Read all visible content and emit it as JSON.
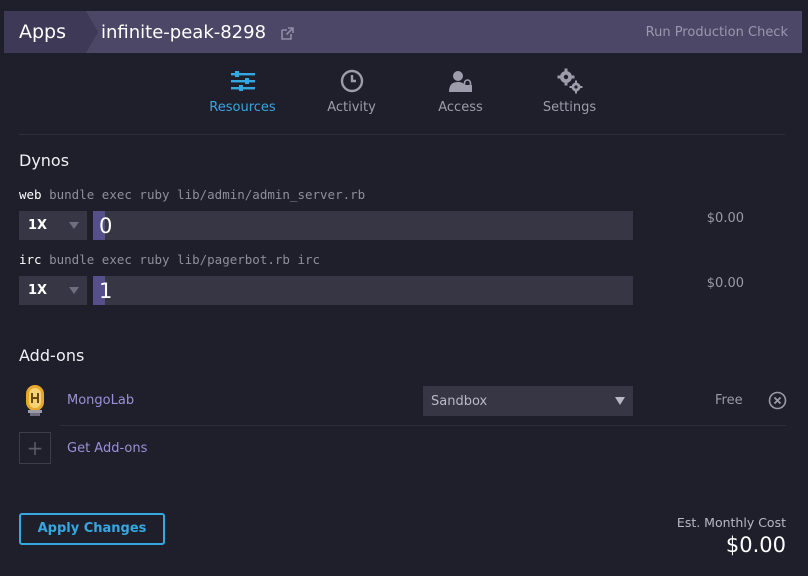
{
  "header": {
    "apps_label": "Apps",
    "app_name": "infinite-peak-8298",
    "run_check_label": "Run Production Check"
  },
  "tabs": [
    {
      "label": "Resources",
      "icon": "sliders-icon",
      "active": true
    },
    {
      "label": "Activity",
      "icon": "clock-icon",
      "active": false
    },
    {
      "label": "Access",
      "icon": "user-lock-icon",
      "active": false
    },
    {
      "label": "Settings",
      "icon": "gears-icon",
      "active": false
    }
  ],
  "dynos": {
    "title": "Dynos",
    "items": [
      {
        "type": "web",
        "command": "bundle exec ruby lib/admin/admin_server.rb",
        "size": "1X",
        "quantity": "0",
        "price": "$0.00"
      },
      {
        "type": "irc",
        "command": "bundle exec ruby lib/pagerbot.rb irc",
        "size": "1X",
        "quantity": "1",
        "price": "$0.00"
      }
    ]
  },
  "addons": {
    "title": "Add-ons",
    "items": [
      {
        "name": "MongoLab",
        "plan": "Sandbox",
        "price": "Free",
        "icon": "mongolab-icon"
      }
    ],
    "get_addons_label": "Get Add-ons"
  },
  "footer": {
    "apply_label": "Apply Changes",
    "est_label": "Est. Monthly Cost",
    "est_value": "$0.00"
  },
  "colors": {
    "background": "#1f1f2b",
    "header": "#4c4766",
    "accent": "#34a7e0",
    "link": "#9c8fd8"
  }
}
